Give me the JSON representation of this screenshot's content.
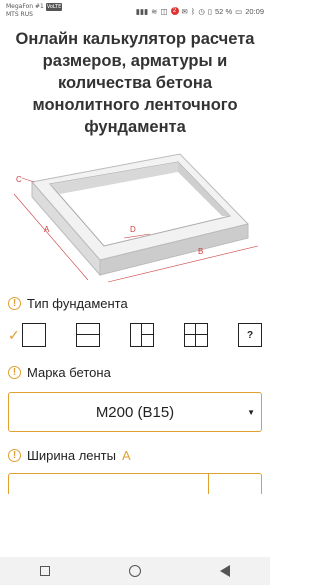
{
  "status_bar": {
    "carrier_1": "MegaFon #1",
    "carrier_2": "MTS RUS",
    "lte": "VoLTE",
    "notif_count": "2",
    "battery": "52 %",
    "time": "20:09"
  },
  "title": "Онлайн калькулятор расчета размеров, арматуры и количества бетона монолитного ленточного фундамента",
  "diagram": {
    "label_a": "A",
    "label_b": "B",
    "label_c": "C",
    "label_d": "D"
  },
  "foundation_type": {
    "label": "Тип фундамента",
    "options": [
      "plain",
      "one-divider",
      "t-divider",
      "cross",
      "custom"
    ],
    "custom_label": "?",
    "selected": 0
  },
  "concrete": {
    "label": "Марка бетона",
    "value": "М200 (В15)"
  },
  "tape_width": {
    "label": "Ширина ленты",
    "accent_letter": "A"
  },
  "colors": {
    "accent": "#e0a030",
    "accent_letter": "#e0a030"
  }
}
